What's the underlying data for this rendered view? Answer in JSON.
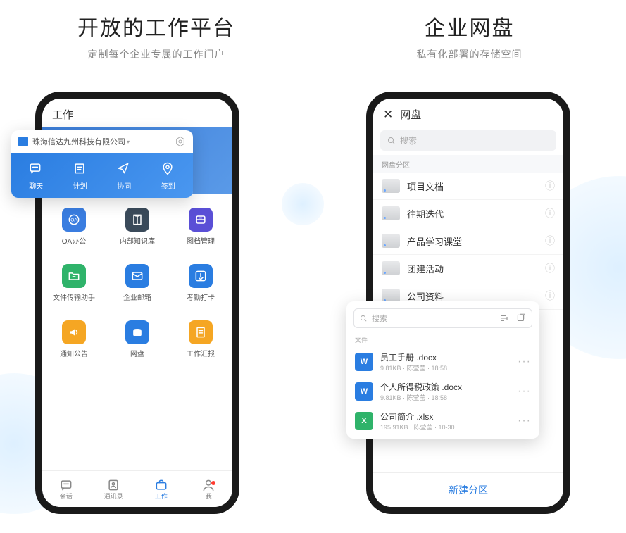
{
  "sections": {
    "left": {
      "title": "开放的工作平台",
      "subtitle": "定制每个企业专属的工作门户"
    },
    "right": {
      "title": "企业网盘",
      "subtitle": "私有化部署的存储空间"
    }
  },
  "workPhone": {
    "header": "工作",
    "apps": [
      {
        "label": "OA办公",
        "color": "#3a7de0",
        "icon": "oa"
      },
      {
        "label": "内部知识库",
        "color": "#3a4a5a",
        "icon": "book"
      },
      {
        "label": "图档管理",
        "color": "#5a4fd6",
        "icon": "drawer"
      },
      {
        "label": "文件传输助手",
        "color": "#2fb36a",
        "icon": "folder"
      },
      {
        "label": "企业邮箱",
        "color": "#2a7de1",
        "icon": "mail"
      },
      {
        "label": "考勤打卡",
        "color": "#2a7de1",
        "icon": "finger"
      },
      {
        "label": "通知公告",
        "color": "#f5a623",
        "icon": "horn"
      },
      {
        "label": "网盘",
        "color": "#2a7de1",
        "icon": "disk"
      },
      {
        "label": "工作汇报",
        "color": "#f5a623",
        "icon": "report"
      }
    ],
    "nav": [
      {
        "label": "会话",
        "icon": "chat"
      },
      {
        "label": "通讯录",
        "icon": "contacts"
      },
      {
        "label": "工作",
        "icon": "briefcase",
        "active": true
      },
      {
        "label": "我",
        "icon": "user",
        "dot": true
      }
    ]
  },
  "popup": {
    "company": "珠海信达九州科技有限公司",
    "actions": [
      {
        "label": "聊天",
        "icon": "chat"
      },
      {
        "label": "计划",
        "icon": "plan"
      },
      {
        "label": "协同",
        "icon": "send"
      },
      {
        "label": "签到",
        "icon": "pin"
      }
    ]
  },
  "netdisk": {
    "title": "网盘",
    "searchPlaceholder": "搜索",
    "sectionLabel": "网盘分区",
    "partitions": [
      "项目文档",
      "往期迭代",
      "产品学习课堂",
      "团建活动",
      "公司资料"
    ],
    "newPartition": "新建分区"
  },
  "fileCard": {
    "searchPlaceholder": "搜索",
    "sectionLabel": "文件",
    "files": [
      {
        "name": "员工手册 .docx",
        "size": "9.81KB",
        "author": "陈莹莹",
        "time": "18:58",
        "type": "word"
      },
      {
        "name": "个人所得税政策 .docx",
        "size": "9.81KB",
        "author": "陈莹莹",
        "time": "18:58",
        "type": "word"
      },
      {
        "name": "公司简介 .xlsx",
        "size": "195.91KB",
        "author": "陈莹莹",
        "time": "10-30",
        "type": "excel"
      }
    ]
  }
}
